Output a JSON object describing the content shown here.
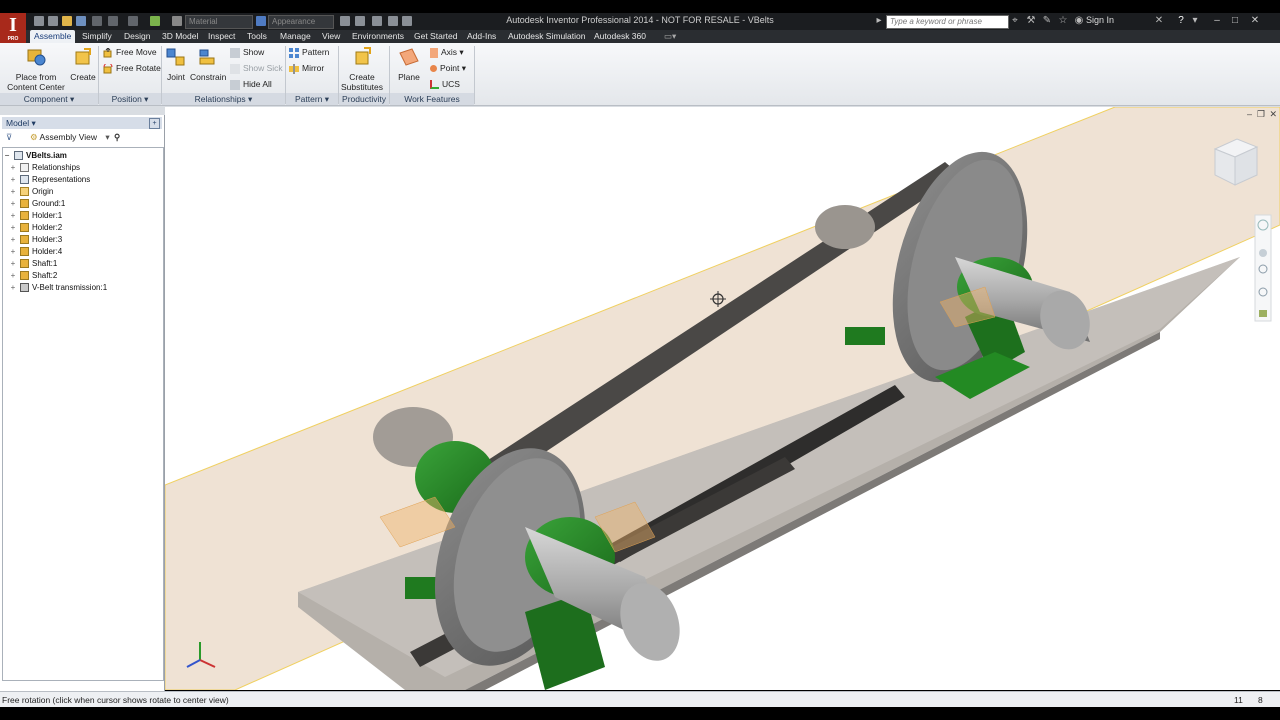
{
  "app": {
    "title": "Autodesk Inventor Professional 2014 - NOT FOR RESALE - VBelts",
    "logo_letter": "I",
    "logo_sub": "PRO"
  },
  "quick_access": {
    "material_placeholder": "Material",
    "appearance_placeholder": "Appearance"
  },
  "search": {
    "placeholder": "Type a keyword or phrase"
  },
  "signin_label": "Sign In",
  "tabs": [
    {
      "label": "Assemble",
      "active": true
    },
    {
      "label": "Simplify"
    },
    {
      "label": "Design"
    },
    {
      "label": "3D Model"
    },
    {
      "label": "Inspect"
    },
    {
      "label": "Tools"
    },
    {
      "label": "Manage"
    },
    {
      "label": "View"
    },
    {
      "label": "Environments"
    },
    {
      "label": "Get Started"
    },
    {
      "label": "Add-Ins"
    },
    {
      "label": "Autodesk Simulation"
    },
    {
      "label": "Autodesk 360"
    }
  ],
  "ribbon": {
    "component": {
      "place_line1": "Place from",
      "place_line2": "Content Center",
      "create": "Create",
      "label": "Component ▾"
    },
    "position": {
      "free_move": "Free Move",
      "free_rotate": "Free Rotate",
      "label": "Position ▾"
    },
    "relationships": {
      "joint": "Joint",
      "constrain": "Constrain",
      "show": "Show",
      "show_sick": "Show Sick",
      "hide_all": "Hide All",
      "label": "Relationships ▾"
    },
    "pattern": {
      "pattern": "Pattern",
      "mirror": "Mirror",
      "label": "Pattern ▾"
    },
    "productivity": {
      "create_line1": "Create",
      "create_line2": "Substitutes",
      "label": "Productivity"
    },
    "work_features": {
      "plane": "Plane",
      "axis": "Axis ▾",
      "point": "Point ▾",
      "ucs": "UCS",
      "label": "Work Features"
    }
  },
  "browser": {
    "header": "Model ▾",
    "view_label": "Assembly View",
    "tree": [
      {
        "label": "VBelts.iam",
        "kind": "root"
      },
      {
        "label": "Relationships",
        "kind": "rel"
      },
      {
        "label": "Representations",
        "kind": "rep"
      },
      {
        "label": "Origin",
        "kind": "org"
      },
      {
        "label": "Ground:1",
        "kind": "part"
      },
      {
        "label": "Holder:1",
        "kind": "part"
      },
      {
        "label": "Holder:2",
        "kind": "part"
      },
      {
        "label": "Holder:3",
        "kind": "part"
      },
      {
        "label": "Holder:4",
        "kind": "part"
      },
      {
        "label": "Shaft:1",
        "kind": "part"
      },
      {
        "label": "Shaft:2",
        "kind": "part"
      },
      {
        "label": "V-Belt transmission:1",
        "kind": "vb"
      }
    ]
  },
  "status": {
    "message": "Free rotation (click when cursor shows rotate to center view)",
    "count1": "11",
    "count2": "8"
  },
  "colors": {
    "title_bg": "#1b1d20",
    "ribbon_bg": "#e8ebef",
    "accent_green": "#2a8a2a",
    "plane_tint": "#e6d2bd",
    "app_red": "#a8291b"
  }
}
